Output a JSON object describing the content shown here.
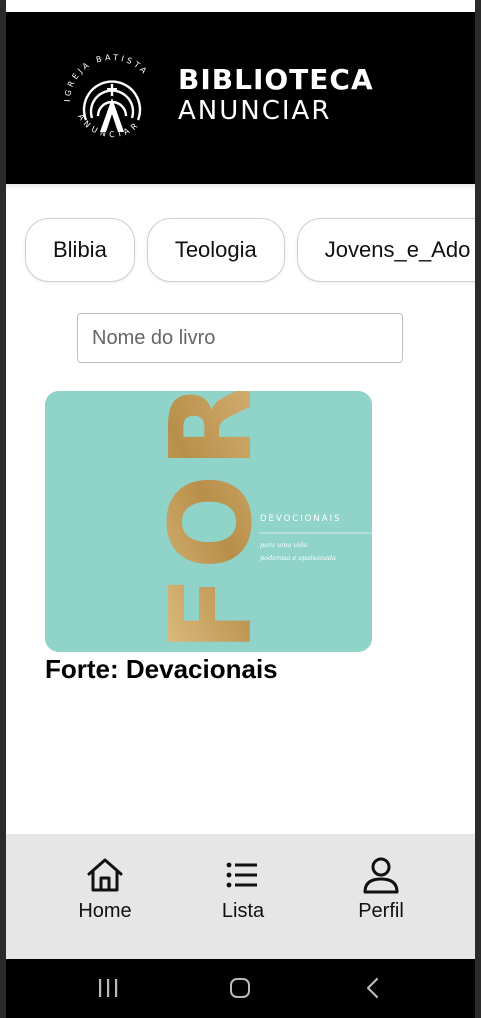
{
  "header": {
    "brand_line1": "BIBLIOTECA",
    "brand_line2": "ANUNCIAR",
    "seal_text_top": "IGREJA BATISTA",
    "seal_text_bottom": "ANUNCIAR"
  },
  "categories": [
    "Blibia",
    "Teologia",
    "Jovens_e_Ado"
  ],
  "search": {
    "placeholder": "Nome do livro",
    "value": ""
  },
  "books": [
    {
      "title": "Forte: Devacionais",
      "cover": {
        "big_letters": "FOR",
        "heading": "DEVOCIONAIS",
        "subtitle_line1": "para uma vida",
        "subtitle_line2": "poderosa e apaixonada",
        "background": "#8fd3c9",
        "accent": "#c9a55a"
      }
    }
  ],
  "bottom_nav": [
    {
      "label": "Home",
      "icon": "home-icon"
    },
    {
      "label": "Lista",
      "icon": "list-icon"
    },
    {
      "label": "Perfil",
      "icon": "user-icon"
    }
  ],
  "colors": {
    "header_bg": "#000000",
    "nav_bg": "#e6e6e6",
    "cover_bg": "#8fd3c9",
    "gold": "#c9a55a"
  }
}
